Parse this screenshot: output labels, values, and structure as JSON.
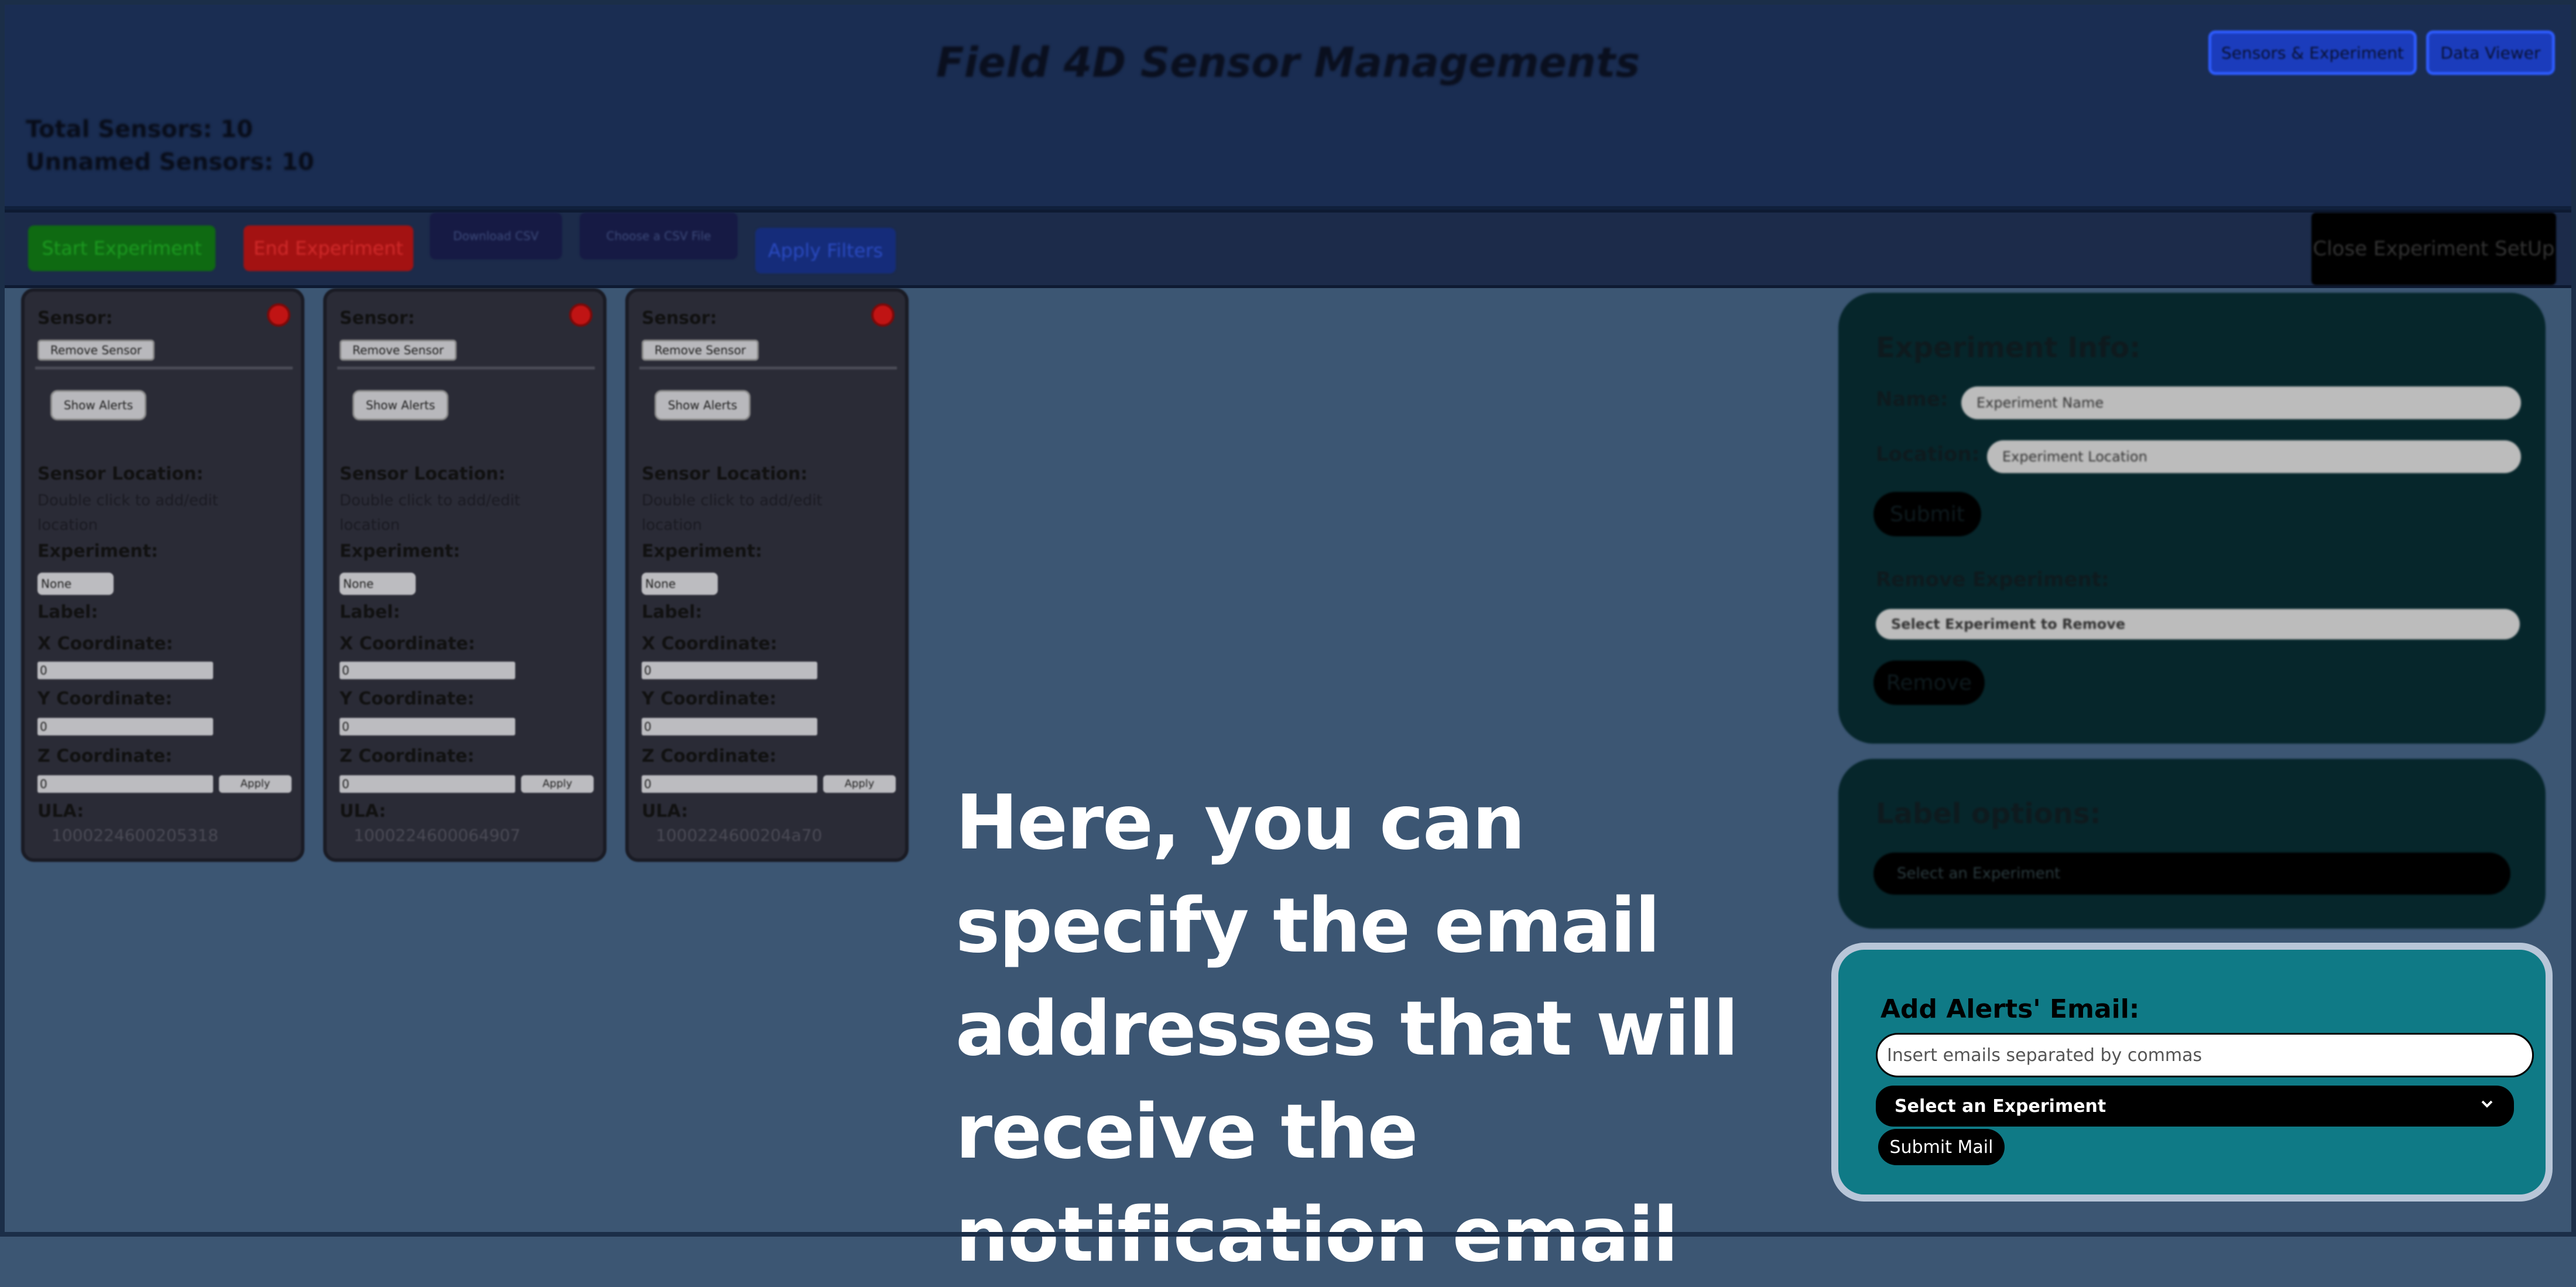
{
  "header": {
    "title": "Field 4D Sensor Managements",
    "total_sensors": "Total Sensors: 10",
    "unnamed_sensors": "Unnamed Sensors: 10",
    "nav_buttons": [
      "Sensors & Experiment",
      "Data Viewer"
    ]
  },
  "toolbar": {
    "start": "Start Experiment",
    "end": "End Experiment",
    "download": "Download CSV",
    "choose_file": "Choose a CSV File",
    "apply_filters": "Apply Filters",
    "close_setup": "Close Experiment SetUp"
  },
  "sensor_card": {
    "title": "Sensor:",
    "remove": "Remove Sensor",
    "show_alerts": "Show Alerts",
    "location_label": "Sensor Location:",
    "location_hint": "Double click to add/edit location",
    "experiment_label": "Experiment:",
    "experiment_value": "None",
    "label_label": "Label:",
    "x_label": "X Coordinate:",
    "y_label": "Y Coordinate:",
    "z_label": "Z Coordinate:",
    "coord_default": "0",
    "apply": "Apply",
    "ula_label": "ULA:"
  },
  "sensors": [
    {
      "ula": "1000224600205318"
    },
    {
      "ula": "1000224600064907"
    },
    {
      "ula": "1000224600204a70"
    }
  ],
  "experiment_panel": {
    "heading": "Experiment Info:",
    "name_label": "Name:",
    "name_placeholder": "Experiment Name",
    "location_label": "Location:",
    "location_placeholder": "Experiment Location",
    "submit": "Submit",
    "remove_heading": "Remove Experiment:",
    "remove_select": "Select Experiment to Remove",
    "remove_button": "Remove"
  },
  "label_panel": {
    "heading": "Label options:",
    "select": "Select an Experiment"
  },
  "email_panel": {
    "title": "Add Alerts' Email:",
    "placeholder": "Insert emails separated by commas",
    "select": "Select an Experiment",
    "submit": "Submit Mail"
  },
  "caption": "Here, you can specify the email addresses that will receive the notification email",
  "colors": {
    "background": "#3c5673",
    "email_panel": "#0f7a86",
    "start_button": "#0f6a12",
    "end_button": "#a31212",
    "sensor_status": "#c01414"
  }
}
